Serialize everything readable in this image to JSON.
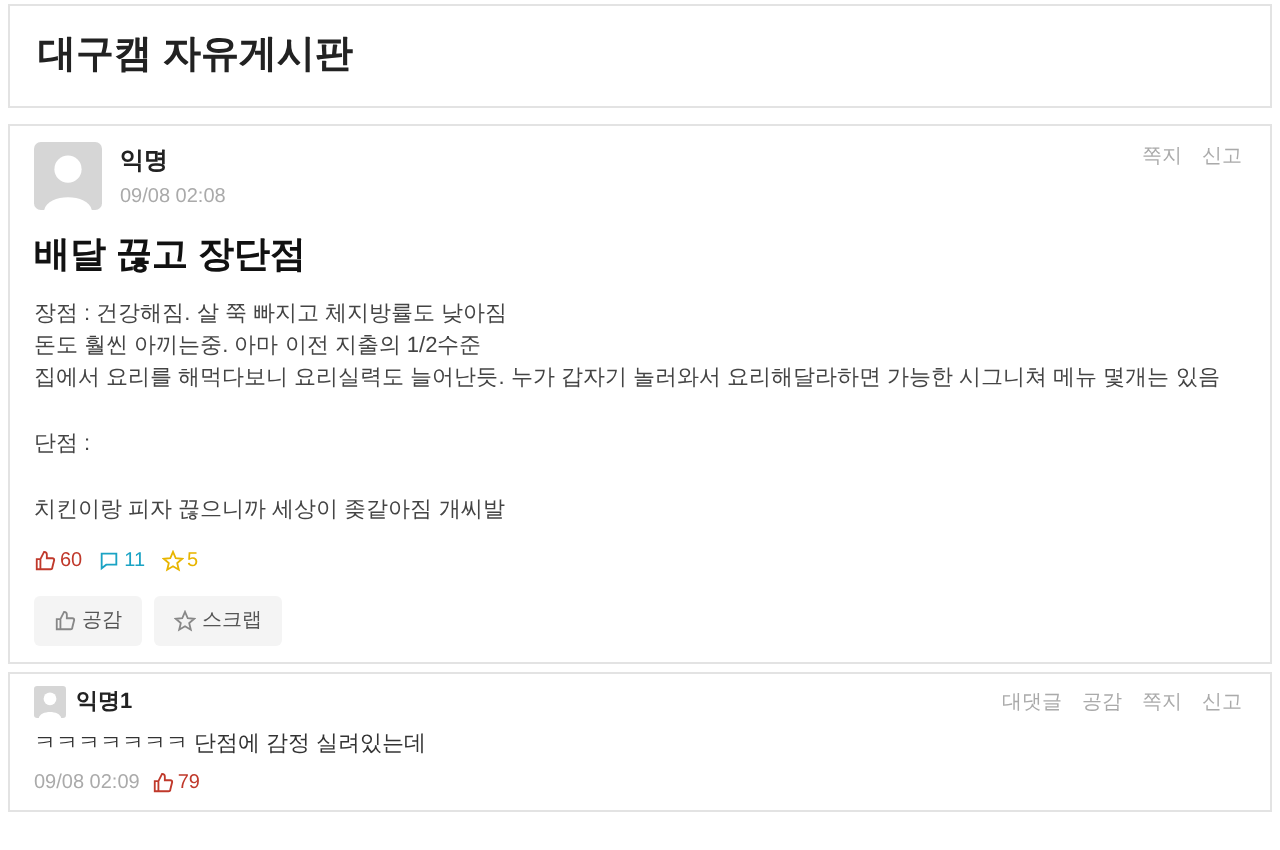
{
  "board": {
    "title": "대구캠 자유게시판"
  },
  "post": {
    "author": "익명",
    "time": "09/08 02:08",
    "actions": [
      "쪽지",
      "신고"
    ],
    "title": "배달 끊고 장단점",
    "body": [
      [
        "장점 : 건강해짐. 살 쭉 빠지고 체지방률도 낮아짐",
        "돈도 훨씬 아끼는중. 아마 이전 지출의 1/2수준",
        "집에서 요리를 해먹다보니 요리실력도 늘어난듯. 누가 갑자기 놀러와서 요리해달라하면 가능한 시그니쳐 메뉴 몇개는 있음"
      ],
      [
        "단점 :"
      ],
      [
        "치킨이랑 피자 끊으니까 세상이 좆같아짐 개씨발"
      ]
    ],
    "stats": {
      "likes": "60",
      "comments": "11",
      "scraps": "5"
    },
    "buttons": [
      {
        "kind": "like",
        "label": "공감"
      },
      {
        "kind": "scrap",
        "label": "스크랩"
      }
    ]
  },
  "comments": [
    {
      "author": "익명1",
      "actions": [
        "대댓글",
        "공감",
        "쪽지",
        "신고"
      ],
      "text": "ㅋㅋㅋㅋㅋㅋㅋ 단점에 감정 실려있는데",
      "time": "09/08 02:09",
      "likes": "79"
    }
  ]
}
